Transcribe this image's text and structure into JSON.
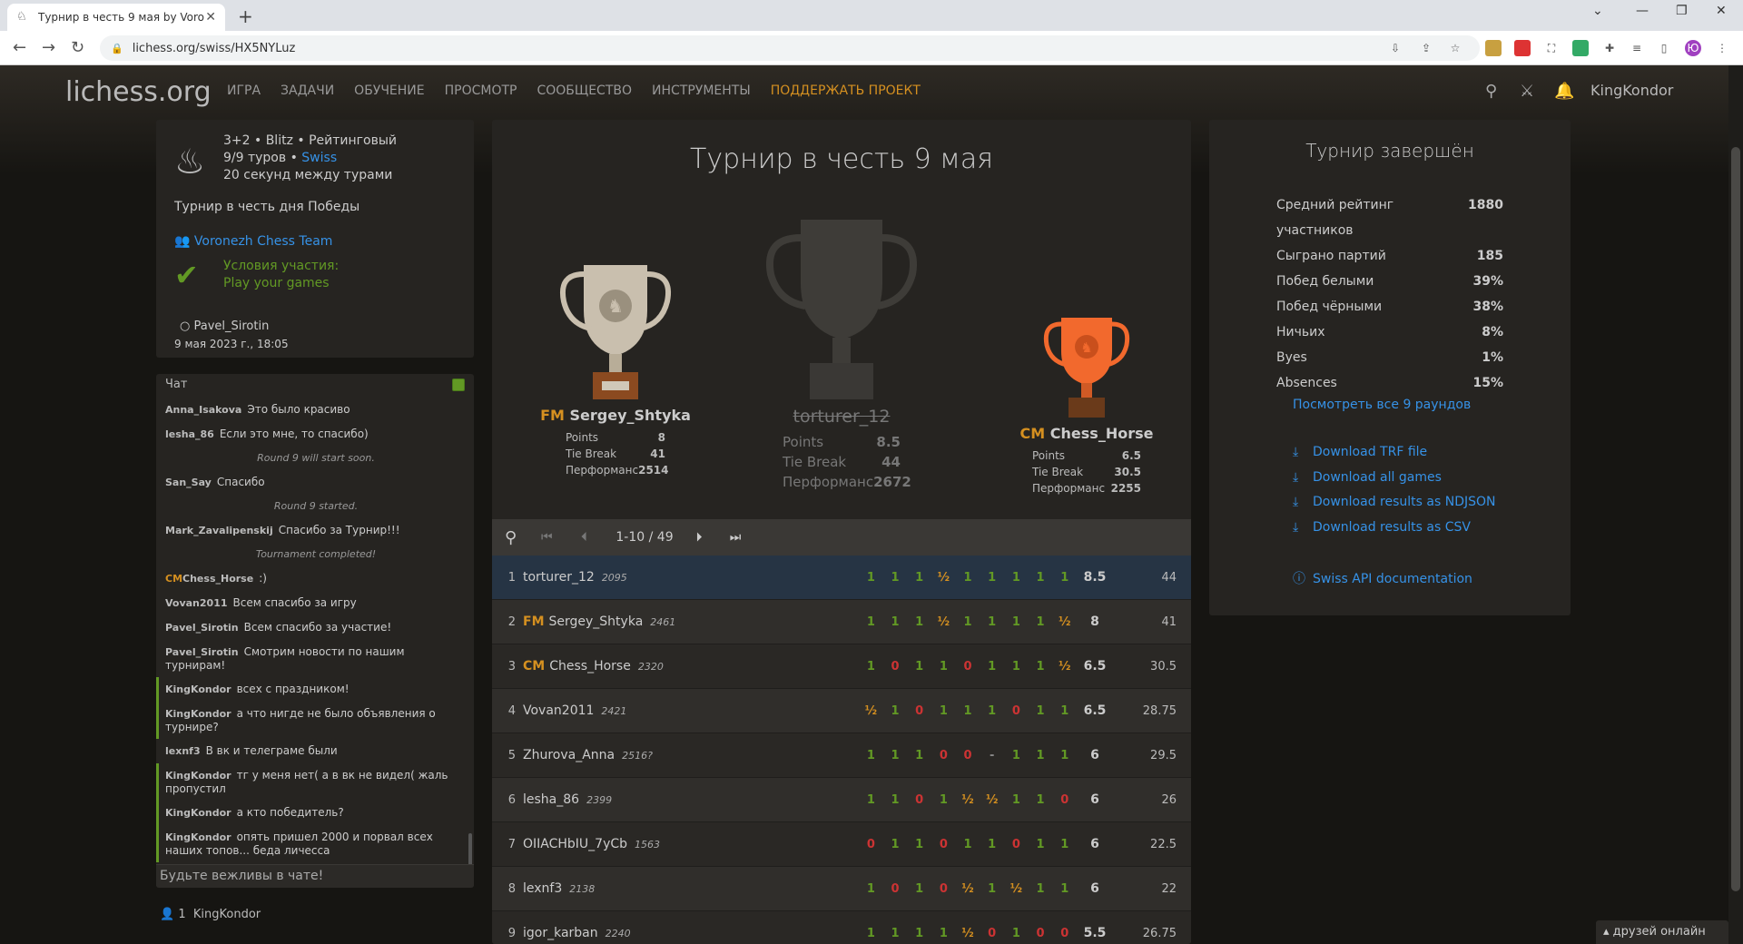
{
  "browser": {
    "tab_title": "Турнир в честь 9 мая by Voronez",
    "url": "lichess.org/swiss/HX5NYLuz",
    "profile_initial": "Ю"
  },
  "header": {
    "logo": "lichess.org",
    "nav": [
      "ИГРА",
      "ЗАДАЧИ",
      "ОБУЧЕНИЕ",
      "ПРОСМОТР",
      "СООБЩЕСТВО",
      "ИНСТРУМЕНТЫ"
    ],
    "donate": "ПОДДЕРЖАТЬ ПРОЕКТ",
    "username": "KingKondor"
  },
  "info": {
    "line1": "3+2 • Blitz • Рейтинговый",
    "line2_prefix": "9/9 туров • ",
    "line2_link": "Swiss",
    "line3": "20 секунд между турами",
    "description": "Турнир в честь дня Победы",
    "team": "Voronezh Chess Team",
    "conditions_title": "Условия участия:",
    "conditions_value": "Play your games",
    "creator": "Pavel_Sirotin",
    "date": "9 мая 2023 г., 18:05"
  },
  "chat": {
    "title": "Чат",
    "placeholder": "Будьте вежливы в чате!",
    "messages": [
      {
        "author": "Anna_Isakova",
        "text": "Это было красиво"
      },
      {
        "author": "lesha_86",
        "text": "Если это мне, то спасибо)"
      },
      {
        "system": "Round 9 will start soon."
      },
      {
        "author": "San_Say",
        "text": "Спасибо"
      },
      {
        "system": "Round 9 started."
      },
      {
        "author": "Mark_Zavalipenskij",
        "text": "Спасибо за Турнир!!!"
      },
      {
        "system": "Tournament completed!"
      },
      {
        "title": "CM",
        "author": "Chess_Horse",
        "text": ":)"
      },
      {
        "author": "Vovan2011",
        "text": "Всем спасибо за игру"
      },
      {
        "author": "Pavel_Sirotin",
        "text": "Всем спасибо за участие!"
      },
      {
        "author": "Pavel_Sirotin",
        "text": "Смотрим новости по нашим турнирам!"
      },
      {
        "author": "KingKondor",
        "text": "всех с праздником!",
        "me": true
      },
      {
        "author": "KingKondor",
        "text": "а что нигде не было объявления о турнире?",
        "me": true
      },
      {
        "author": "lexnf3",
        "text": "В вк и телеграме были"
      },
      {
        "author": "KingKondor",
        "text": "тг у меня нет( а в вк не видел( жаль пропустил",
        "me": true
      },
      {
        "author": "KingKondor",
        "text": "а кто победитель?",
        "me": true
      },
      {
        "author": "KingKondor",
        "text": "опять пришел 2000 и порвал всех наших топов... беда личесса",
        "me": true
      }
    ],
    "watchers_count": "1",
    "watcher": "KingKondor"
  },
  "tournament": {
    "title": "Турнир в честь 9 мая",
    "podium": {
      "first": {
        "name": "torturer_12",
        "points": "8.5",
        "tiebreak": "44",
        "perf": "2672"
      },
      "second": {
        "title": "FM",
        "name": "Sergey_Shtyka",
        "points": "8",
        "tiebreak": "41",
        "perf": "2514"
      },
      "third": {
        "title": "CM",
        "name": "Chess_Horse",
        "points": "6.5",
        "tiebreak": "30.5",
        "perf": "2255"
      }
    },
    "labels": {
      "points": "Points",
      "tiebreak": "Tie Break",
      "perf": "Перформанс"
    },
    "pager": "1-10 / 49",
    "standings": [
      {
        "rank": "1",
        "title": "",
        "name": "torturer_12",
        "rating": "2095",
        "sheet": [
          "1",
          "1",
          "1",
          "½",
          "1",
          "1",
          "1",
          "1",
          "1"
        ],
        "points": "8.5",
        "tb": "44",
        "me": true
      },
      {
        "rank": "2",
        "title": "FM",
        "name": "Sergey_Shtyka",
        "rating": "2461",
        "sheet": [
          "1",
          "1",
          "1",
          "½",
          "1",
          "1",
          "1",
          "1",
          "½"
        ],
        "points": "8",
        "tb": "41"
      },
      {
        "rank": "3",
        "title": "CM",
        "name": "Chess_Horse",
        "rating": "2320",
        "sheet": [
          "1",
          "0",
          "1",
          "1",
          "0",
          "1",
          "1",
          "1",
          "½"
        ],
        "points": "6.5",
        "tb": "30.5"
      },
      {
        "rank": "4",
        "title": "",
        "name": "Vovan2011",
        "rating": "2421",
        "sheet": [
          "½",
          "1",
          "0",
          "1",
          "1",
          "1",
          "0",
          "1",
          "1"
        ],
        "points": "6.5",
        "tb": "28.75"
      },
      {
        "rank": "5",
        "title": "",
        "name": "Zhurova_Anna",
        "rating": "2516?",
        "sheet": [
          "1",
          "1",
          "1",
          "0",
          "0",
          "-",
          "1",
          "1",
          "1"
        ],
        "points": "6",
        "tb": "29.5"
      },
      {
        "rank": "6",
        "title": "",
        "name": "lesha_86",
        "rating": "2399",
        "sheet": [
          "1",
          "1",
          "0",
          "1",
          "½",
          "½",
          "1",
          "1",
          "0"
        ],
        "points": "6",
        "tb": "26"
      },
      {
        "rank": "7",
        "title": "",
        "name": "OIIACHbIU_7yCb",
        "rating": "1563",
        "sheet": [
          "0",
          "1",
          "1",
          "0",
          "1",
          "1",
          "0",
          "1",
          "1"
        ],
        "points": "6",
        "tb": "22.5"
      },
      {
        "rank": "8",
        "title": "",
        "name": "lexnf3",
        "rating": "2138",
        "sheet": [
          "1",
          "0",
          "1",
          "0",
          "½",
          "1",
          "½",
          "1",
          "1"
        ],
        "points": "6",
        "tb": "22"
      },
      {
        "rank": "9",
        "title": "",
        "name": "igor_karban",
        "rating": "2240",
        "sheet": [
          "1",
          "1",
          "1",
          "1",
          "½",
          "0",
          "1",
          "0",
          "0"
        ],
        "points": "5.5",
        "tb": "26.75"
      }
    ]
  },
  "side": {
    "title": "Турнир завершён",
    "stats": [
      {
        "label": "Средний рейтинг участников",
        "value": "1880"
      },
      {
        "label": "Сыграно партий",
        "value": "185"
      },
      {
        "label": "Побед белыми",
        "value": "39%"
      },
      {
        "label": "Побед чёрными",
        "value": "38%"
      },
      {
        "label": "Ничьих",
        "value": "8%"
      },
      {
        "label": "Byes",
        "value": "1%"
      },
      {
        "label": "Absences",
        "value": "15%"
      }
    ],
    "rounds_link": "Посмотреть все 9 раундов",
    "downloads": [
      "Download TRF file",
      "Download all games",
      "Download results as NDJSON",
      "Download results as CSV"
    ],
    "api": "Swiss API documentation"
  },
  "friends": "друзей онлайн"
}
